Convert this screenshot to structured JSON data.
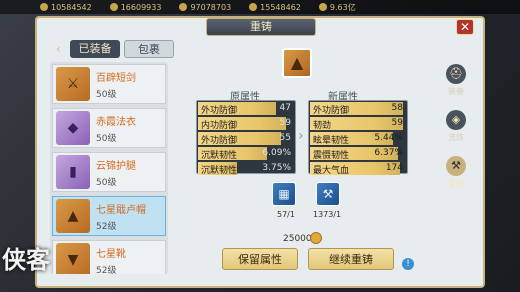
{
  "topbar": {
    "resources": [
      "10584542",
      "16609933",
      "97078703",
      "15548462",
      "9.63亿"
    ]
  },
  "panel": {
    "title": "重铸",
    "close_label": "✕"
  },
  "tabs": {
    "equipped": "已装备",
    "bag": "包裹"
  },
  "items": [
    {
      "name": "百辟短剑",
      "level": "50级",
      "icon": "sword-icon"
    },
    {
      "name": "赤霞法衣",
      "level": "50级",
      "icon": "armor-icon"
    },
    {
      "name": "云锦护腿",
      "level": "50级",
      "icon": "leggings-icon"
    },
    {
      "name": "七星戢卢帽",
      "level": "52级",
      "icon": "hat-icon",
      "selected": true
    },
    {
      "name": "七星靴",
      "level": "52级",
      "icon": "boots-icon"
    }
  ],
  "original": {
    "header": "原属性",
    "rows": [
      {
        "label": "外功防御",
        "value": "47",
        "fill": 0.8
      },
      {
        "label": "内功防御",
        "value": "59",
        "fill": 0.9
      },
      {
        "label": "外功防御",
        "value": "55",
        "fill": 0.85
      },
      {
        "label": "沉默韧性",
        "value": "6.09%",
        "fill": 0.7
      },
      {
        "label": "沉默韧性",
        "value": "3.75%",
        "fill": 0.4
      }
    ]
  },
  "new": {
    "header": "新属性",
    "rows": [
      {
        "label": "外功防御",
        "value": "58",
        "fill": 0.95
      },
      {
        "label": "韧劲",
        "value": "59",
        "fill": 0.95
      },
      {
        "label": "眩晕韧性",
        "value": "5.44%",
        "fill": 0.85
      },
      {
        "label": "震慑韧性",
        "value": "6.37%",
        "fill": 0.9
      },
      {
        "label": "最大气血",
        "value": "174",
        "fill": 0.92
      }
    ]
  },
  "materials": [
    {
      "icon": "ore-icon",
      "count": "57/1"
    },
    {
      "icon": "hammer-icon",
      "count": "1373/1"
    }
  ],
  "cost": "25000",
  "buttons": {
    "keep": "保留属性",
    "continue": "继续重铸"
  },
  "side_nav": [
    {
      "label": "装备",
      "icon": "helmet-icon",
      "active": false
    },
    {
      "label": "洗炼",
      "icon": "wash-icon",
      "active": false
    },
    {
      "label": "重铸",
      "icon": "hammer-icon",
      "active": true
    }
  ],
  "logo": "侠客"
}
